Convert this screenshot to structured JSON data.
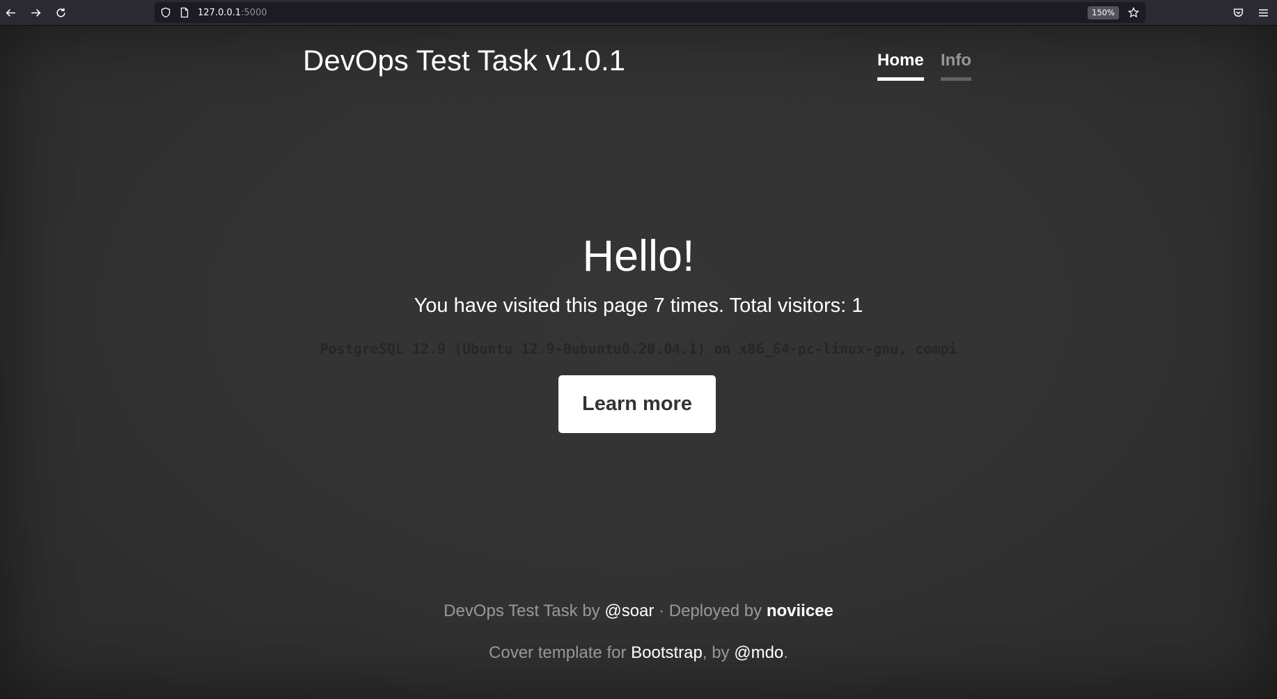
{
  "browser": {
    "url_host": "127.0.0.1",
    "url_port": ":5000",
    "zoom": "150%"
  },
  "header": {
    "brand": "DevOps Test Task v1.0.1",
    "nav": [
      {
        "label": "Home",
        "active": true
      },
      {
        "label": "Info",
        "active": false
      }
    ]
  },
  "main": {
    "heading": "Hello!",
    "visits_text": "You have visited this page 7 times. Total visitors: 1",
    "db_version": "PostgreSQL 12.9 (Ubuntu 12.9-0ubuntu0.20.04.1) on x86_64-pc-linux-gnu, compi",
    "button_label": "Learn more"
  },
  "footer": {
    "line1_prefix": "DevOps Test Task by ",
    "line1_author": "@soar",
    "line1_middle": " · Deployed by ",
    "line1_deployer": "noviicee",
    "line2_prefix": "Cover template for ",
    "line2_link1": "Bootstrap",
    "line2_middle": ", by ",
    "line2_link2": "@mdo",
    "line2_suffix": "."
  }
}
